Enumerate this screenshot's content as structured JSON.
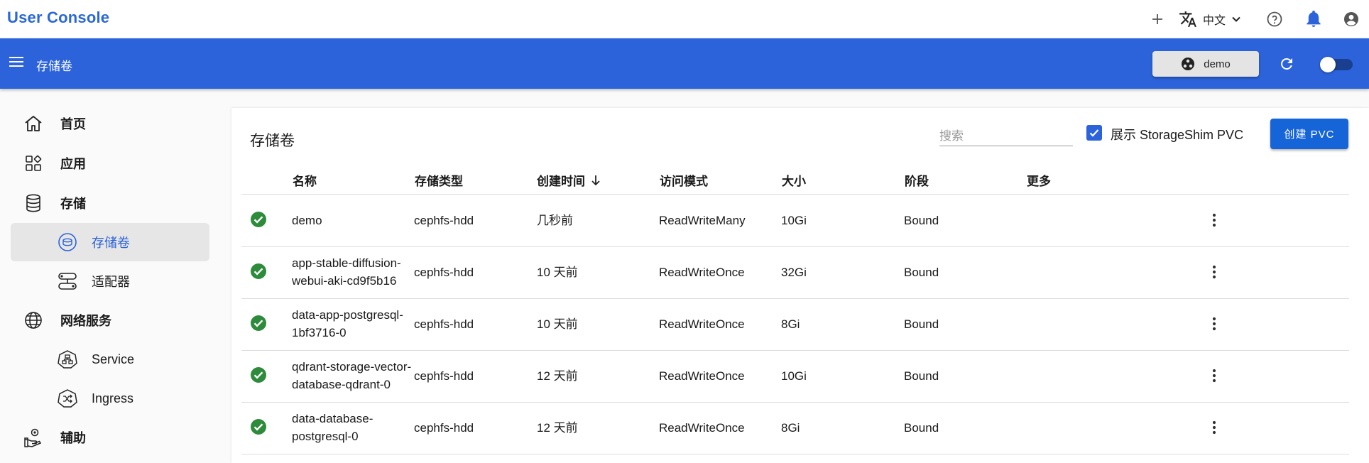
{
  "app": {
    "title": "User Console",
    "lang": "中文"
  },
  "header": {
    "page": "存储卷",
    "namespace": "demo"
  },
  "sidebar": {
    "items": [
      {
        "label": "首页"
      },
      {
        "label": "应用"
      },
      {
        "label": "存储"
      },
      {
        "label": "存储卷"
      },
      {
        "label": "适配器"
      },
      {
        "label": "网络服务"
      },
      {
        "label": "Service"
      },
      {
        "label": "Ingress"
      },
      {
        "label": "辅助"
      }
    ]
  },
  "main": {
    "title": "存储卷",
    "search_placeholder": "搜索",
    "checkbox_label": "展示 StorageShim PVC",
    "checkbox_checked": true,
    "create_label": "创建 PVC",
    "columns": [
      "名称",
      "存储类型",
      "创建时间",
      "访问模式",
      "大小",
      "阶段",
      "更多"
    ],
    "rows": [
      {
        "name": "demo",
        "storage": "cephfs-hdd",
        "created": "几秒前",
        "access": "ReadWriteMany",
        "size": "10Gi",
        "phase": "Bound"
      },
      {
        "name": "app-stable-diffusion-webui-aki-cd9f5b16",
        "storage": "cephfs-hdd",
        "created": "10 天前",
        "access": "ReadWriteOnce",
        "size": "32Gi",
        "phase": "Bound"
      },
      {
        "name": "data-app-postgresql-1bf3716-0",
        "storage": "cephfs-hdd",
        "created": "10 天前",
        "access": "ReadWriteOnce",
        "size": "8Gi",
        "phase": "Bound"
      },
      {
        "name": "qdrant-storage-vector-database-qdrant-0",
        "storage": "cephfs-hdd",
        "created": "12 天前",
        "access": "ReadWriteOnce",
        "size": "10Gi",
        "phase": "Bound"
      },
      {
        "name": "data-database-postgresql-0",
        "storage": "cephfs-hdd",
        "created": "12 天前",
        "access": "ReadWriteOnce",
        "size": "8Gi",
        "phase": "Bound"
      }
    ]
  },
  "colors": {
    "primary": "#2c63db",
    "success": "#2e8b3c"
  }
}
